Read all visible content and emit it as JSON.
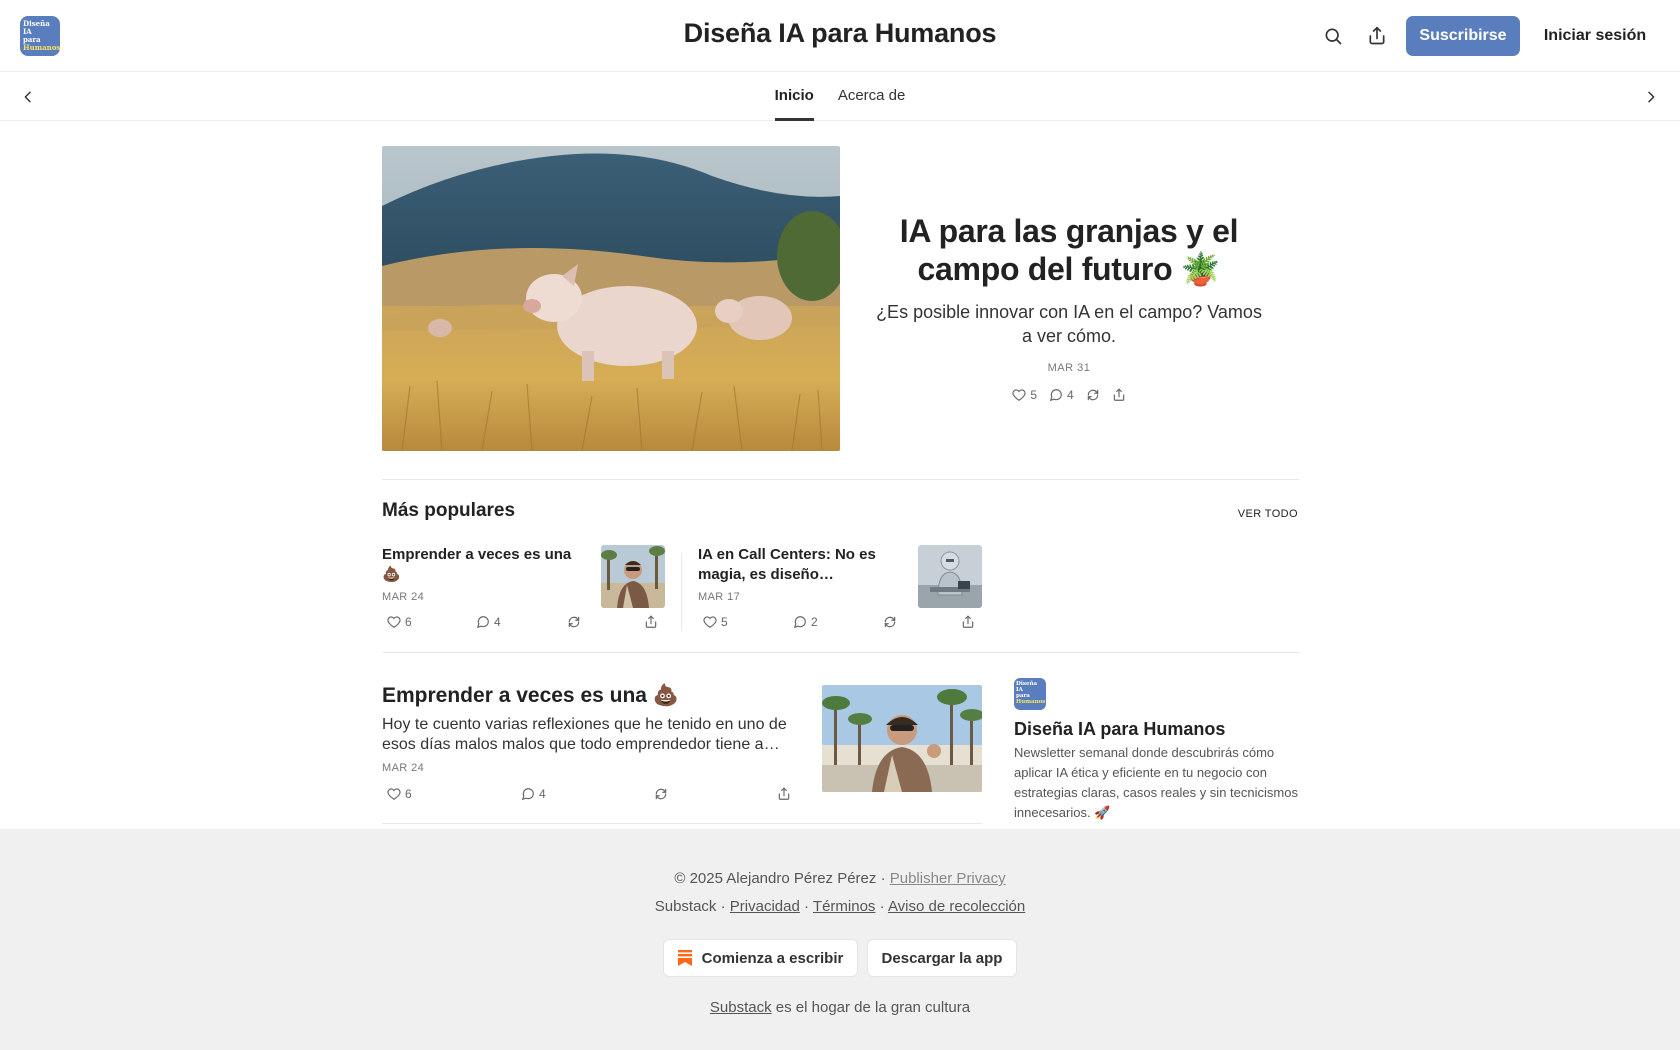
{
  "header": {
    "logo_lines": [
      "Diseña IA",
      "para",
      "Humanos"
    ],
    "title": "Diseña IA para Humanos",
    "subscribe_label": "Suscribirse",
    "signin_label": "Iniciar sesión"
  },
  "nav": {
    "tabs": [
      {
        "label": "Inicio",
        "active": true
      },
      {
        "label": "Acerca de",
        "active": false
      }
    ]
  },
  "hero": {
    "title": "IA para las granjas y el campo del futuro 🪴",
    "subtitle": "¿Es posible innovar con IA en el campo? Vamos a ver cómo.",
    "date": "MAR 31",
    "likes": "5",
    "comments": "4"
  },
  "popular": {
    "heading": "Más populares",
    "see_all": "VER TODO",
    "items": [
      {
        "title": "Emprender a veces es una 💩",
        "date": "MAR 24",
        "likes": "6",
        "comments": "4"
      },
      {
        "title": "IA en Call Centers: No es magia, es diseño…",
        "date": "MAR 17",
        "likes": "5",
        "comments": "2"
      }
    ]
  },
  "post": {
    "title": "Emprender a veces es una 💩",
    "excerpt": "Hoy te cuento varias reflexiones que he tenido en uno de esos días malos malos que todo emprendedor tiene a…",
    "date": "MAR 24",
    "likes": "6",
    "comments": "4"
  },
  "sidebar": {
    "logo_lines": [
      "Diseña IA",
      "para",
      "Humanos"
    ],
    "name": "Diseña IA para Humanos",
    "description": "Newsletter semanal donde descubrirás cómo aplicar IA ética y eficiente en tu negocio con estrategias claras, casos reales y sin tecnicismos innecesarios. 🚀"
  },
  "footer": {
    "copyright": "© 2025 Alejandro Pérez Pérez",
    "publisher_privacy": "Publisher Privacy",
    "substack": "Substack",
    "privacy": "Privacidad",
    "terms": "Términos",
    "collection_notice": "Aviso de recolección",
    "start_writing": "Comienza a escribir",
    "get_app": "Descargar la app",
    "tagline_link": "Substack",
    "tagline_rest": "es el hogar de la gran cultura"
  },
  "colors": {
    "accent": "#5a7ebd",
    "footer_bg": "#f0f0f0",
    "substack_orange": "#ff6719"
  },
  "icons": [
    "search-icon",
    "share-icon",
    "chevron-left-icon",
    "chevron-right-icon",
    "heart-icon",
    "comment-icon",
    "restack-icon",
    "substack-bookmark-icon"
  ]
}
